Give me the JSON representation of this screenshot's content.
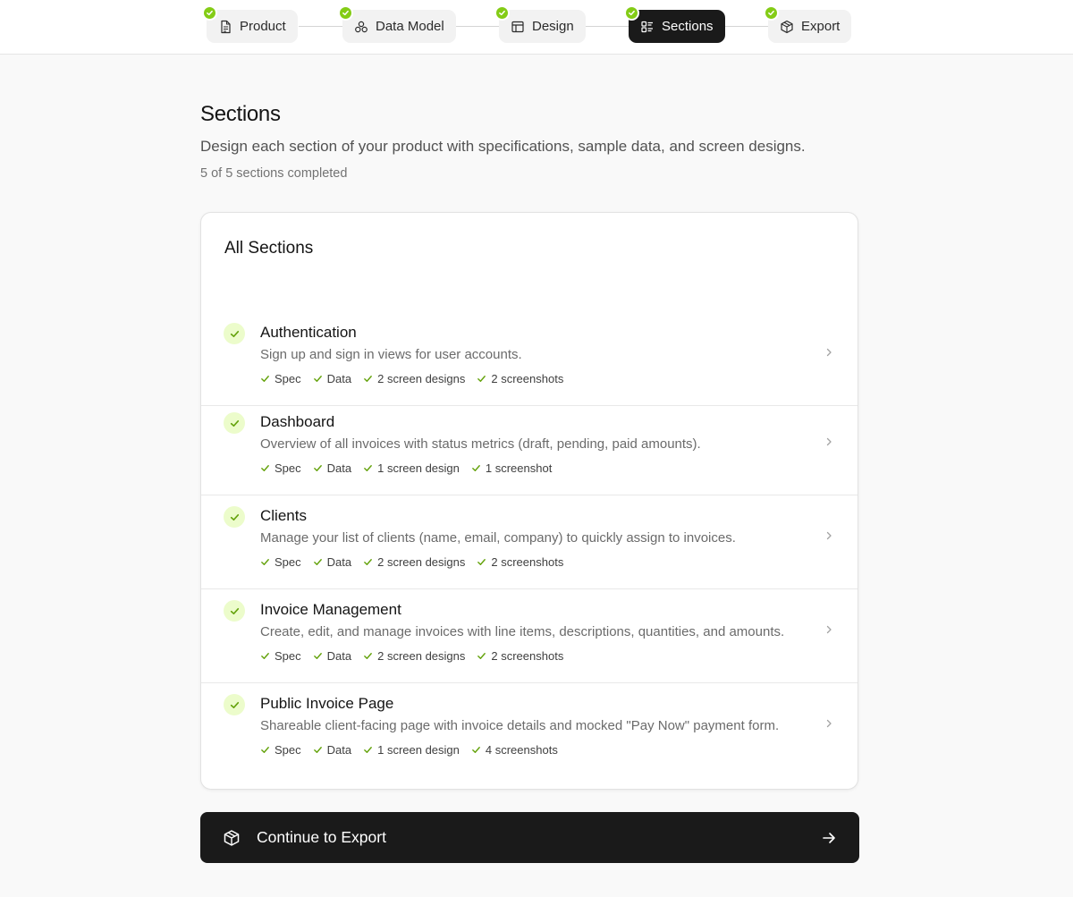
{
  "colors": {
    "accent_green": "#84cc16",
    "check_bg": "#ecfccb",
    "dark": "#1a1a1a"
  },
  "stepper": {
    "steps": [
      {
        "label": "Product",
        "icon": "document-icon",
        "completed": true,
        "active": false
      },
      {
        "label": "Data Model",
        "icon": "network-icon",
        "completed": true,
        "active": false
      },
      {
        "label": "Design",
        "icon": "layout-icon",
        "completed": true,
        "active": false
      },
      {
        "label": "Sections",
        "icon": "list-icon",
        "completed": true,
        "active": true
      },
      {
        "label": "Export",
        "icon": "package-icon",
        "completed": true,
        "active": false
      }
    ]
  },
  "header": {
    "title": "Sections",
    "subtitle": "Design each section of your product with specifications, sample data, and screen designs.",
    "progress": "5 of 5 sections completed"
  },
  "card": {
    "title": "All Sections",
    "sections": [
      {
        "name": "Authentication",
        "description": "Sign up and sign in views for user accounts.",
        "items": [
          "Spec",
          "Data",
          "2 screen designs",
          "2 screenshots"
        ]
      },
      {
        "name": "Dashboard",
        "description": "Overview of all invoices with status metrics (draft, pending, paid amounts).",
        "items": [
          "Spec",
          "Data",
          "1 screen design",
          "1 screenshot"
        ]
      },
      {
        "name": "Clients",
        "description": "Manage your list of clients (name, email, company) to quickly assign to invoices.",
        "items": [
          "Spec",
          "Data",
          "2 screen designs",
          "2 screenshots"
        ]
      },
      {
        "name": "Invoice Management",
        "description": "Create, edit, and manage invoices with line items, descriptions, quantities, and amounts.",
        "items": [
          "Spec",
          "Data",
          "2 screen designs",
          "2 screenshots"
        ]
      },
      {
        "name": "Public Invoice Page",
        "description": "Shareable client-facing page with invoice details and mocked \"Pay Now\" payment form.",
        "items": [
          "Spec",
          "Data",
          "1 screen design",
          "4 screenshots"
        ]
      }
    ]
  },
  "continue_button": {
    "label": "Continue to Export",
    "icon": "package-icon",
    "trailing_icon": "arrow-right-icon"
  }
}
